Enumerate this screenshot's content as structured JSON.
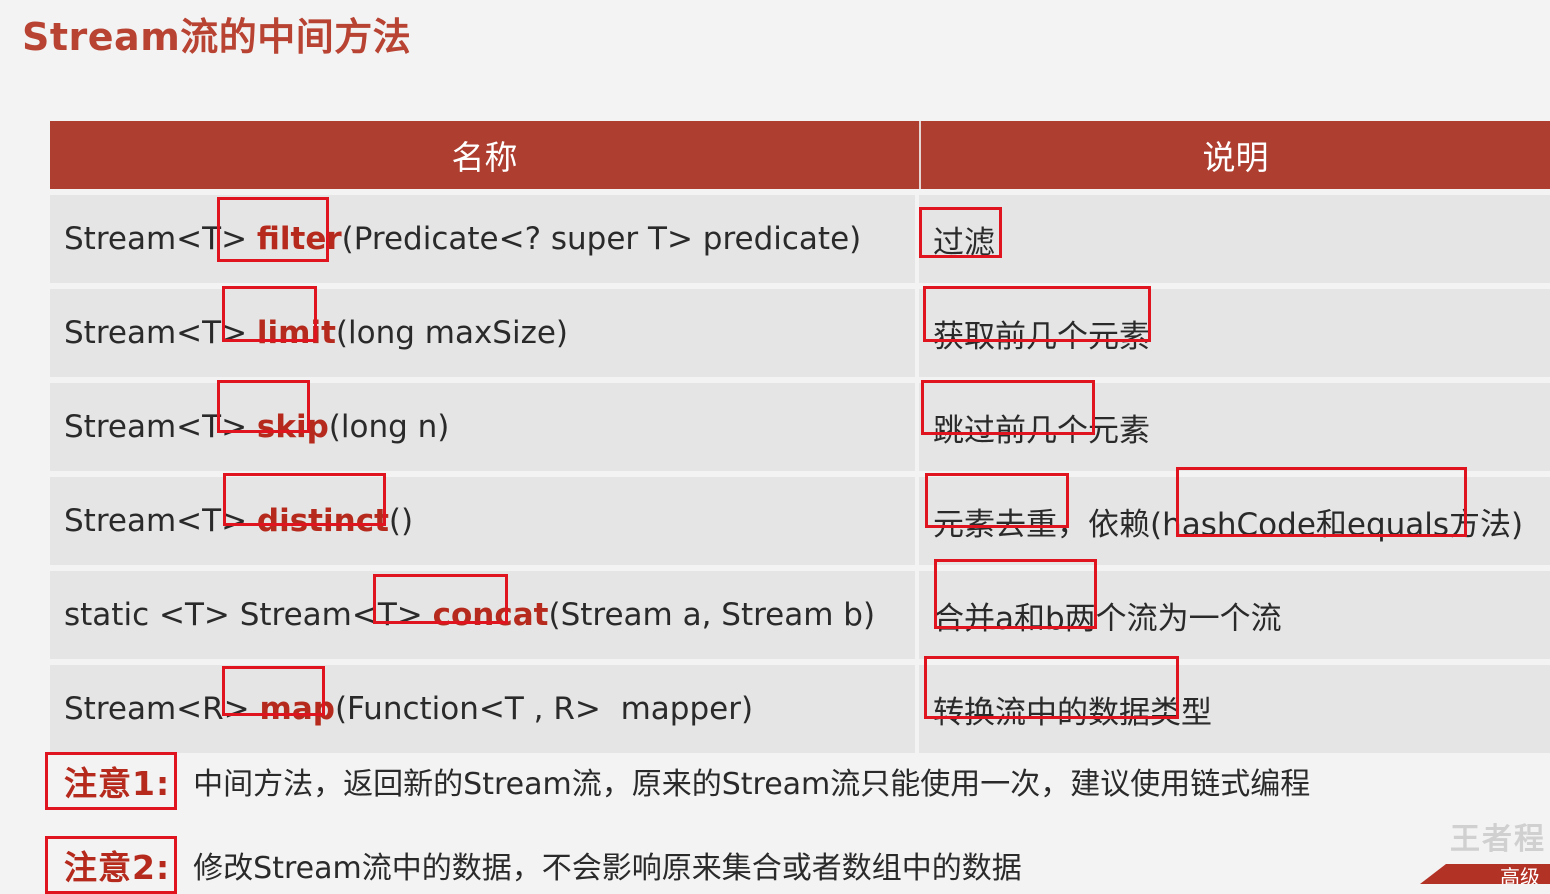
{
  "title": "Stream流的中间方法",
  "table": {
    "headers": [
      "名称",
      "说明"
    ],
    "rows": [
      {
        "before": "Stream<T> ",
        "keyword": "filter",
        "after": "(Predicate<? super T> predicate)",
        "desc": "过滤"
      },
      {
        "before": "Stream<T> ",
        "keyword": "limit",
        "after": "(long maxSize)",
        "desc": "获取前几个元素"
      },
      {
        "before": "Stream<T> ",
        "keyword": "skip",
        "after": "(long n)",
        "desc": "跳过前几个元素"
      },
      {
        "before": "Stream<T> ",
        "keyword": "distinct",
        "after": "()",
        "desc": "元素去重，依赖(hashCode和equals方法)"
      },
      {
        "before": "static <T> Stream<T> ",
        "keyword": "concat",
        "after": "(Stream a, Stream b)",
        "desc": "合并a和b两个流为一个流"
      },
      {
        "before": "Stream<R> ",
        "keyword": "map",
        "after": "(Function<T , R>  mapper)",
        "desc": "转换流中的数据类型"
      }
    ]
  },
  "notes": [
    {
      "label": "注意1:",
      "text": "中间方法，返回新的Stream流，原来的Stream流只能使用一次，建议使用链式编程"
    },
    {
      "label": "注意2:",
      "text": "修改Stream流中的数据，不会影响原来集合或者数组中的数据"
    }
  ],
  "corner_text": "高级",
  "watermark": "王者程",
  "colors": {
    "header_bg": "#ad3e30",
    "title": "#b84332",
    "keyword": "#b52a1c",
    "highlight_box": "#e0141e",
    "row_bg": "#e5e5e5"
  }
}
